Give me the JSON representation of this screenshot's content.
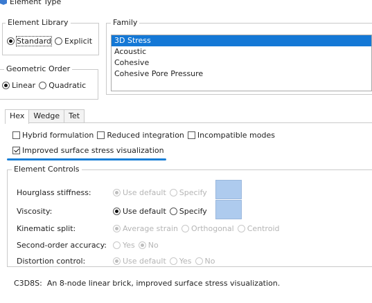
{
  "window": {
    "title": "Element Type"
  },
  "element_library": {
    "legend": "Element Library",
    "options": [
      {
        "label": "Standard",
        "selected": true
      },
      {
        "label": "Explicit",
        "selected": false
      }
    ]
  },
  "family": {
    "legend": "Family",
    "items": [
      "3D Stress",
      "Acoustic",
      "Cohesive",
      "Cohesive Pore Pressure"
    ],
    "selected": "3D Stress"
  },
  "geometric_order": {
    "legend": "Geometric Order",
    "options": [
      {
        "label": "Linear",
        "selected": true
      },
      {
        "label": "Quadratic",
        "selected": false
      }
    ]
  },
  "tabs": [
    "Hex",
    "Wedge",
    "Tet"
  ],
  "active_tab": "Hex",
  "options": {
    "hybrid": {
      "label": "Hybrid formulation",
      "checked": false
    },
    "reduced": {
      "label": "Reduced integration",
      "checked": false
    },
    "incompatible": {
      "label": "Incompatible modes",
      "checked": false
    },
    "improved": {
      "label": "Improved surface stress visualization",
      "checked": true
    }
  },
  "element_controls": {
    "legend": "Element Controls",
    "hourglass": {
      "label": "Hourglass stiffness:",
      "use_default": "Use default",
      "specify": "Specify",
      "enabled": false
    },
    "viscosity": {
      "label": "Viscosity:",
      "use_default": "Use default",
      "specify": "Specify",
      "enabled": true
    },
    "kinematic": {
      "label": "Kinematic split:",
      "opt1": "Average strain",
      "opt2": "Orthogonal",
      "opt3": "Centroid",
      "enabled": false
    },
    "second_order": {
      "label": "Second-order accuracy:",
      "opt1": "Yes",
      "opt2": "No",
      "enabled": false
    },
    "distortion": {
      "label": "Distortion control:",
      "opt1": "Use default",
      "opt2": "Yes",
      "opt3": "No",
      "enabled": false
    }
  },
  "description": "C3D8S:  An 8-node linear brick, improved surface stress visualization.",
  "colors": {
    "accent": "#1478d6",
    "swatch": "#aecbee",
    "underline": "#1a7fd6"
  }
}
